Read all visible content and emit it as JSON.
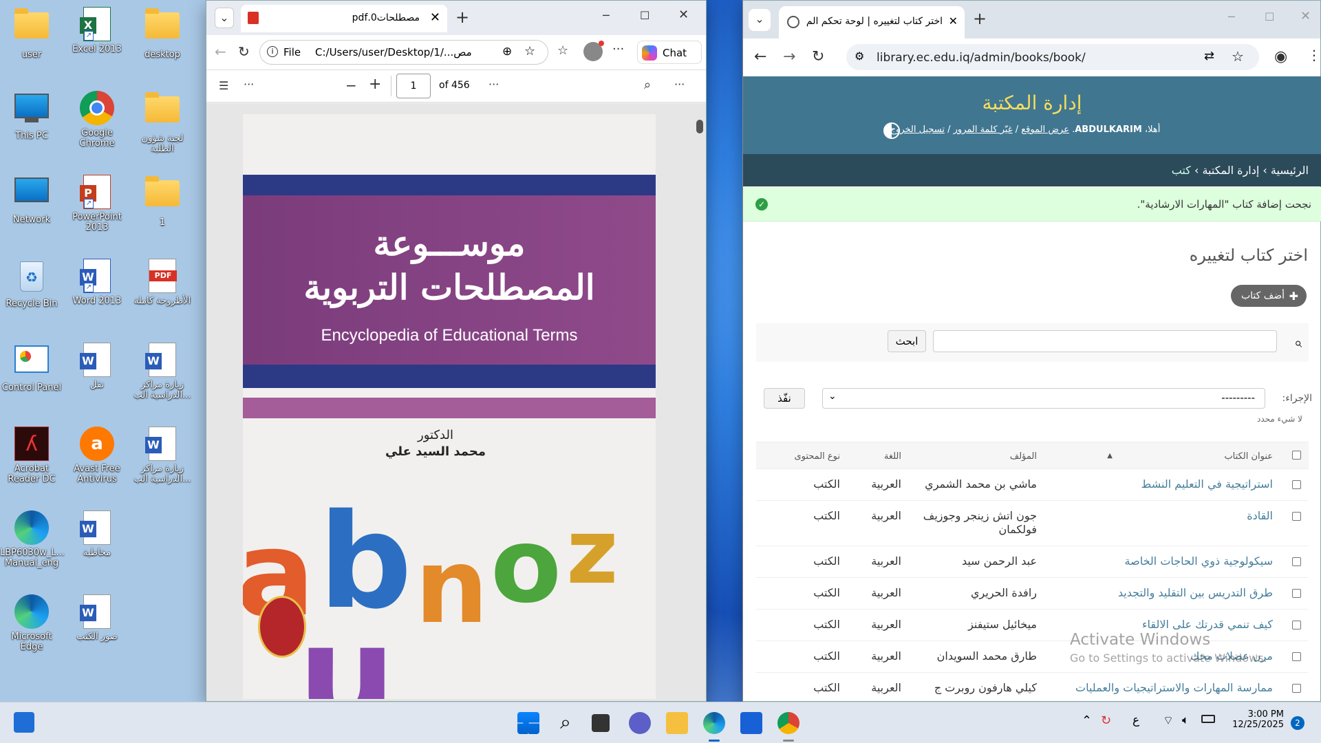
{
  "desktop": {
    "icons": [
      {
        "label": "user"
      },
      {
        "label": "Excel 2013"
      },
      {
        "label": "desktop"
      },
      {
        "label": "This PC"
      },
      {
        "label": "Google Chrome"
      },
      {
        "label": "لجنة شؤون الطلبة"
      },
      {
        "label": "Network"
      },
      {
        "label": "PowerPoint 2013"
      },
      {
        "label": "1"
      },
      {
        "label": "Recycle Bin"
      },
      {
        "label": "Word 2013"
      },
      {
        "label": "الأطروحة كاملة"
      },
      {
        "label": "Control Panel"
      },
      {
        "label": "نقل"
      },
      {
        "label": "زيارة مراكز الدراسية الب..."
      },
      {
        "label": "Acrobat Reader DC"
      },
      {
        "label": "Avast Free Antivirus"
      },
      {
        "label": "زيارة مراكز الدراسية الب..."
      },
      {
        "label": "LBP6030w_L... Manual_eng"
      },
      {
        "label": "مخاطبة"
      },
      {
        "label": "Microsoft Edge"
      },
      {
        "label": "صور الكتب"
      }
    ]
  },
  "edge": {
    "tab_title": "مصطلحات0.pdf",
    "address_prefix": "File",
    "address": "C:/Users/user/Desktop/1/...مص",
    "copilot_label": "Chat",
    "page_current": "1",
    "page_total": "of 456",
    "cover": {
      "title_line1": "موســـوعة",
      "title_line2": "المصطلحات التربوية",
      "title_en": "Encyclopedia of Educational Terms",
      "doctor": "الدكتور",
      "author": "محمد السيد علي"
    }
  },
  "chrome": {
    "tab_title": "اختر كتاب لتغييره | لوحة تحكم الم",
    "url": "library.ec.edu.iq/admin/books/book/",
    "site_title": "إدارة المكتبة",
    "user_tools": {
      "welcome": "أهلا،",
      "username": "ABDULKARIM",
      "view_site": "عرض الموقع",
      "change_password": "غيّر كلمة المرور",
      "logout": "تسجيل الخروج"
    },
    "breadcrumbs": [
      "الرئيسية",
      "إدارة المكتبة",
      "كتب"
    ],
    "success_message": "نجحت إضافة كتاب \"المهارات الارشادية\".",
    "page_heading": "اختر كتاب لتغييره",
    "add_button": "أضف كتاب",
    "search_button": "ابحث",
    "search_value": "",
    "action_label": "الإجراء:",
    "action_selected": "---------",
    "execute_button": "نفّذ",
    "selection_count": "لا شيء محدد",
    "columns": [
      "عنوان الكتاب",
      "المؤلف",
      "اللغة",
      "نوع المحتوى"
    ],
    "rows": [
      {
        "title": "استراتيجية في التعليم النشط",
        "author": "ماشي بن محمد الشمري",
        "language": "العربية",
        "type": "الكتب"
      },
      {
        "title": "القادة",
        "author": "جون اتش زينجر وجوزيف فولكمان",
        "language": "العربية",
        "type": "الكتب"
      },
      {
        "title": "سيكولوجية ذوي الحاجات الخاصة",
        "author": "عبد الرحمن سيد",
        "language": "العربية",
        "type": "الكتب"
      },
      {
        "title": "طرق التدريس بين التقليد والتجديد",
        "author": "رافدة الحريري",
        "language": "العربية",
        "type": "الكتب"
      },
      {
        "title": "كيف تنمي قدرتك على الالقاء",
        "author": "ميخائيل ستيفنز",
        "language": "العربية",
        "type": "الكتب"
      },
      {
        "title": "مرن عضلات مخك",
        "author": "طارق محمد السويدان",
        "language": "العربية",
        "type": "الكتب"
      },
      {
        "title": "ممارسة المهارات والاستراتيجيات والعمليات",
        "author": "كيلي هارفون روبرت ج",
        "language": "العربية",
        "type": "الكتب"
      }
    ]
  },
  "watermark": {
    "line1": "Activate Windows",
    "line2": "Go to Settings to activate Windows."
  },
  "taskbar": {
    "time": "3:00 PM",
    "date": "12/25/2025",
    "lang": "ع",
    "notifications": "2"
  },
  "colors": {
    "django_header": "#417690",
    "django_breadcrumb": "#2b4a5a",
    "django_title": "#f5dd5d",
    "success_bg": "#dfd",
    "link": "#447e9b"
  }
}
